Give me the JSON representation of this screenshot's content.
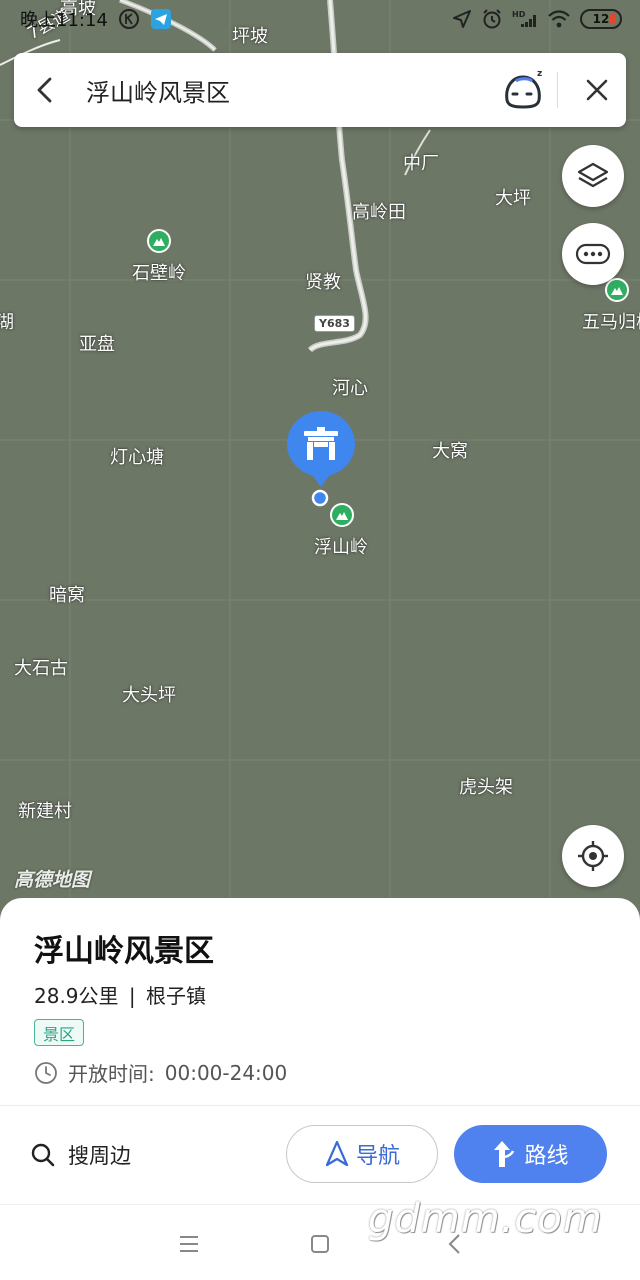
{
  "status_bar": {
    "time": "晚上11:14",
    "battery": "12"
  },
  "search": {
    "query": "浮山岭风景区"
  },
  "map": {
    "provider_logo": "高德地图",
    "road_badge": "Y683",
    "road_label": "7县道",
    "top_labels": [
      "高坡",
      "坪坡"
    ],
    "places": [
      {
        "name": "中厂"
      },
      {
        "name": "大坪"
      },
      {
        "name": "高岭田"
      },
      {
        "name": "石壁岭"
      },
      {
        "name": "贤教"
      },
      {
        "name": "五马归槽"
      },
      {
        "name": "湖"
      },
      {
        "name": "亚盘"
      },
      {
        "name": "河心"
      },
      {
        "name": "灯心塘"
      },
      {
        "name": "大窝"
      },
      {
        "name": "浮山岭"
      },
      {
        "name": "暗窝"
      },
      {
        "name": "大石古"
      },
      {
        "name": "大头坪"
      },
      {
        "name": "虎头架"
      },
      {
        "name": "新建村"
      }
    ]
  },
  "poi": {
    "title": "浮山岭风景区",
    "distance": "28.9公里",
    "separator": "|",
    "town": "根子镇",
    "tag": "景区",
    "hours_label": "开放时间:",
    "hours_value": "00:00-24:00"
  },
  "actions": {
    "nearby": "搜周边",
    "navigate": "导航",
    "route": "路线"
  },
  "watermark": "gdmm.com",
  "colors": {
    "map_bg": "#6d7766",
    "accent_blue": "#4f82ee",
    "tag_green": "#2fa387",
    "peak_green": "#2fae62"
  }
}
